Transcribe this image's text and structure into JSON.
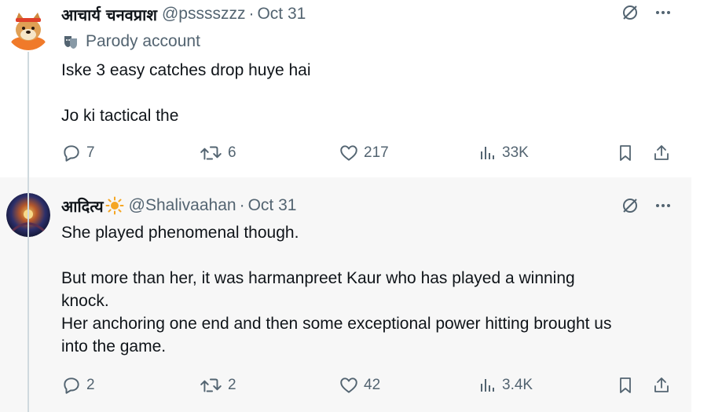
{
  "tweets": [
    {
      "author_name": "आचार्य चनवप्राश",
      "handle": "@psssszzz",
      "separator": "·",
      "date": "Oct 31",
      "label": "Parody account",
      "text": "Iske 3 easy catches drop huye hai\n\nJo ki tactical the",
      "replies": "7",
      "reposts": "6",
      "likes": "217",
      "views": "33K"
    },
    {
      "author_name": "आदित्य",
      "handle": "@Shalivaahan",
      "separator": "·",
      "date": "Oct 31",
      "text": "She played phenomenal though.\n\nBut more than her, it was harmanpreet Kaur who has played a winning\nknock.\nHer anchoring one end and then some exceptional power hitting brought us\ninto the game.",
      "replies": "2",
      "reposts": "2",
      "likes": "42",
      "views": "3.4K"
    }
  ],
  "colors": {
    "text": "#0f1419",
    "secondary": "#536471",
    "thread_line": "#cfd9de",
    "hover_bg": "#f7f7f7"
  },
  "icons": [
    "grok-icon",
    "more-icon",
    "parody-mask-icon",
    "reply-icon",
    "repost-icon",
    "like-icon",
    "views-icon",
    "bookmark-icon",
    "share-icon",
    "sun-emoji"
  ]
}
